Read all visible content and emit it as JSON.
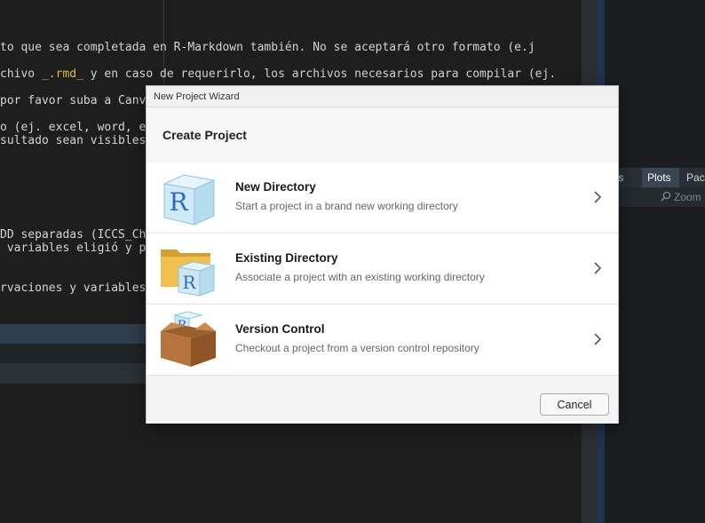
{
  "editor": {
    "lines": [
      {
        "pre": "to que sea completada en R-Markdown también. No se aceptará otro formato (e.j",
        "hl": "",
        "post": ""
      },
      {
        "pre": "chivo ",
        "hl": "_.rmd_",
        "post": " y en caso de requerirlo, los archivos necesarios para compilar (ej."
      },
      {
        "pre": "por favor suba a Canv",
        "hl": "",
        "post": ""
      },
      {
        "pre": "o (ej. excel, word, e",
        "hl": "",
        "post": ""
      },
      {
        "pre": "sultado sean visibles",
        "hl": "",
        "post": ""
      },
      {
        "pre": "DD separadas (ICCS_Ch",
        "hl": "",
        "post": ""
      },
      {
        "pre": " variables eligió y p",
        "hl": "",
        "post": ""
      },
      {
        "pre": "rvaciones y variables",
        "hl": "",
        "post": ""
      }
    ]
  },
  "right_pane": {
    "tabs": [
      "les",
      "Plots",
      "Pack"
    ],
    "active_tab": "Plots",
    "zoom_label": "Zoom"
  },
  "dialog": {
    "window_title": "New Project Wizard",
    "header_title": "Create Project",
    "options": [
      {
        "title": "New Directory",
        "description": "Start a project in a brand new working directory",
        "icon": "r-cube-icon"
      },
      {
        "title": "Existing Directory",
        "description": "Associate a project with an existing working directory",
        "icon": "folder-r-icon"
      },
      {
        "title": "Version Control",
        "description": "Checkout a project from a version control repository",
        "icon": "box-r-icon"
      }
    ],
    "cancel_label": "Cancel"
  },
  "colors": {
    "r_blue": "#2a6bbf",
    "cube_fill": "#cfe9f7",
    "folder": "#e9b949",
    "box": "#b5743d"
  }
}
